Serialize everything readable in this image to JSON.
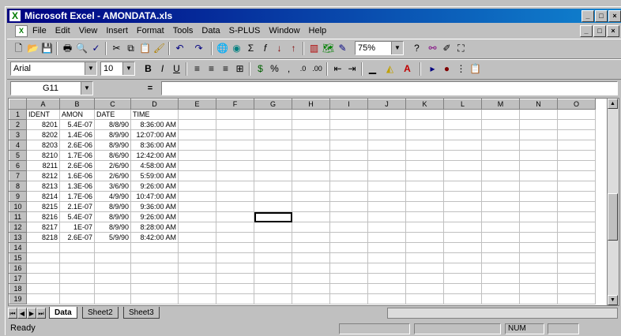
{
  "window": {
    "title": "Microsoft Excel - AMONDATA.xls",
    "app_icon": "excel-icon",
    "controls": [
      "_",
      "□",
      "×"
    ]
  },
  "menu": {
    "items": [
      "File",
      "Edit",
      "View",
      "Insert",
      "Format",
      "Tools",
      "Data",
      "S-PLUS",
      "Window",
      "Help"
    ],
    "doc_controls": [
      "_",
      "□",
      "×"
    ]
  },
  "toolbar": {
    "zoom": "75%"
  },
  "format_toolbar": {
    "font": "Arial",
    "size": "10"
  },
  "formula_bar": {
    "name_box": "G11",
    "equals": "=",
    "content": ""
  },
  "sheet": {
    "columns": [
      "A",
      "B",
      "C",
      "D",
      "E",
      "F",
      "G",
      "H",
      "I",
      "J",
      "K",
      "L",
      "M",
      "N",
      "O"
    ],
    "rows": [
      {
        "n": "1",
        "cells": [
          "IDENT",
          "AMON",
          "DATE",
          "TIME"
        ]
      },
      {
        "n": "2",
        "cells": [
          "8201",
          "5.4E-07",
          "8/8/90",
          "8:36:00 AM"
        ]
      },
      {
        "n": "3",
        "cells": [
          "8202",
          "1.4E-06",
          "8/9/90",
          "12:07:00 AM"
        ]
      },
      {
        "n": "4",
        "cells": [
          "8203",
          "2.6E-06",
          "8/9/90",
          "8:36:00 AM"
        ]
      },
      {
        "n": "5",
        "cells": [
          "8210",
          "1.7E-06",
          "8/6/90",
          "12:42:00 AM"
        ]
      },
      {
        "n": "6",
        "cells": [
          "8211",
          "2.6E-06",
          "2/6/90",
          "4:58:00 AM"
        ]
      },
      {
        "n": "7",
        "cells": [
          "8212",
          "1.6E-06",
          "2/6/90",
          "5:59:00 AM"
        ]
      },
      {
        "n": "8",
        "cells": [
          "8213",
          "1.3E-06",
          "3/6/90",
          "9:26:00 AM"
        ]
      },
      {
        "n": "9",
        "cells": [
          "8214",
          "1.7E-06",
          "4/9/90",
          "10:47:00 AM"
        ]
      },
      {
        "n": "10",
        "cells": [
          "8215",
          "2.1E-07",
          "8/9/90",
          "9:36:00 AM"
        ]
      },
      {
        "n": "11",
        "cells": [
          "8216",
          "5.4E-07",
          "8/9/90",
          "9:26:00 AM"
        ]
      },
      {
        "n": "12",
        "cells": [
          "8217",
          "1E-07",
          "8/9/90",
          "8:28:00 AM"
        ]
      },
      {
        "n": "13",
        "cells": [
          "8218",
          "2.6E-07",
          "5/9/90",
          "8:42:00 AM"
        ]
      },
      {
        "n": "14",
        "cells": [
          "",
          "",
          "",
          ""
        ]
      },
      {
        "n": "15",
        "cells": [
          "",
          "",
          "",
          ""
        ]
      },
      {
        "n": "16",
        "cells": [
          "",
          "",
          "",
          ""
        ]
      },
      {
        "n": "17",
        "cells": [
          "",
          "",
          "",
          ""
        ]
      },
      {
        "n": "18",
        "cells": [
          "",
          "",
          "",
          ""
        ]
      },
      {
        "n": "19",
        "cells": [
          "",
          "",
          "",
          ""
        ]
      }
    ],
    "selected_cell": "G11",
    "tabs": [
      "Data",
      "Sheet2",
      "Sheet3"
    ],
    "active_tab": "Data"
  },
  "status": {
    "mode": "Ready",
    "num": "NUM"
  }
}
